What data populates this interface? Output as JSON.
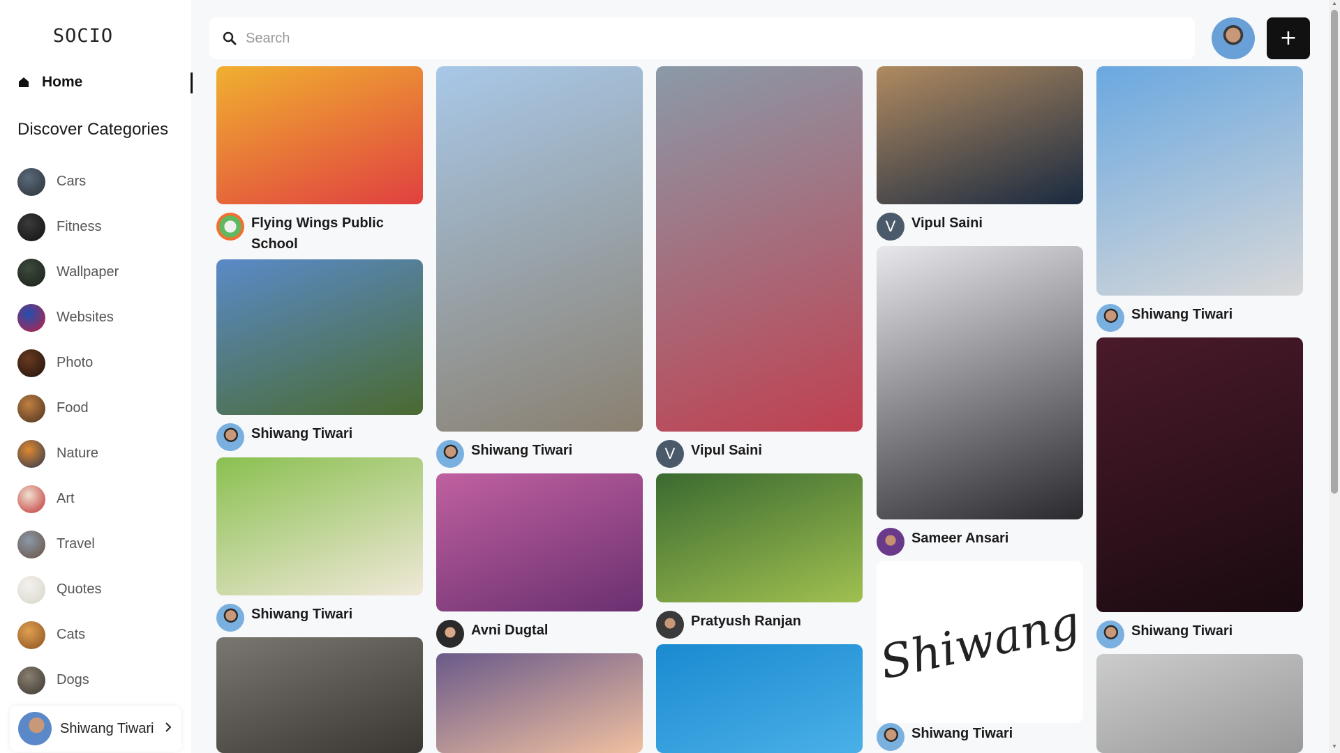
{
  "sidebar": {
    "logo": "SOCIO",
    "home_label": "Home",
    "categories_title": "Discover Categories",
    "categories": [
      {
        "label": "Cars",
        "colors": [
          "#5a6a7a",
          "#2c3036"
        ]
      },
      {
        "label": "Fitness",
        "colors": [
          "#3a3a3a",
          "#111"
        ]
      },
      {
        "label": "Wallpaper",
        "colors": [
          "#3d4a3d",
          "#1a1f1a"
        ]
      },
      {
        "label": "Websites",
        "colors": [
          "#2050b0",
          "#c02040"
        ]
      },
      {
        "label": "Photo",
        "colors": [
          "#6a3a20",
          "#1e120a"
        ]
      },
      {
        "label": "Food",
        "colors": [
          "#c08040",
          "#4a3020"
        ]
      },
      {
        "label": "Nature",
        "colors": [
          "#e08a30",
          "#2a3550"
        ]
      },
      {
        "label": "Art",
        "colors": [
          "#f0e0d0",
          "#c03030"
        ]
      },
      {
        "label": "Travel",
        "colors": [
          "#8a98a8",
          "#6a5040"
        ]
      },
      {
        "label": "Quotes",
        "colors": [
          "#f4f2ee",
          "#d8d4cc"
        ]
      },
      {
        "label": "Cats",
        "colors": [
          "#e0a050",
          "#8a5020"
        ]
      },
      {
        "label": "Dogs",
        "colors": [
          "#8a8070",
          "#3a3530"
        ]
      }
    ],
    "profile_name": "Shiwang Tiwari"
  },
  "search": {
    "placeholder": "Search"
  },
  "add_label": "+",
  "pins": [
    {
      "author": "Flying Wings Public School",
      "colors": [
        "#f0b030",
        "#e04040"
      ]
    },
    {
      "author": "Shiwang Tiwari",
      "colors": [
        "#5a8ac8",
        "#4a6a30"
      ]
    },
    {
      "author": "Shiwang Tiwari",
      "colors": [
        "#8ac050",
        "#f0e8d8"
      ]
    },
    {
      "author": "",
      "colors": [
        "#7a7670",
        "#3a3632"
      ]
    },
    {
      "author": "Shiwang Tiwari",
      "colors": [
        "#a8c8e8",
        "#8a8070"
      ]
    },
    {
      "author": "Avni Dugtal",
      "colors": [
        "#c060a0",
        "#6a3070"
      ]
    },
    {
      "author": "",
      "colors": [
        "#6a5a8a",
        "#f0c0a0"
      ]
    },
    {
      "author": "Vipul Saini",
      "colors": [
        "#8a9aa8",
        "#c04050"
      ]
    },
    {
      "author": "Pratyush Ranjan",
      "colors": [
        "#3a6a30",
        "#a0c050"
      ]
    },
    {
      "author": "",
      "colors": [
        "#1a8ad0",
        "#4ab0e8"
      ]
    },
    {
      "author": "Vipul Saini",
      "colors": [
        "#b08a60",
        "#1a2a40"
      ]
    },
    {
      "author": "Sameer Ansari",
      "colors": [
        "#e8e8ec",
        "#2a2a2e"
      ]
    },
    {
      "author": "Shiwang Tiwari",
      "signature": "Shiwang",
      "colors": [
        "#ffffff",
        "#ffffff"
      ]
    },
    {
      "author": "Shiwang Tiwari",
      "colors": [
        "#f4f4f4",
        "#bdbdbd"
      ]
    },
    {
      "author": "Shiwang Tiwari",
      "colors": [
        "#6aa8e0",
        "#d8d8d8"
      ]
    },
    {
      "author": "",
      "colors": [
        "#4a1a2a",
        "#1a0a10"
      ]
    }
  ],
  "avatars": {
    "V": "V"
  }
}
